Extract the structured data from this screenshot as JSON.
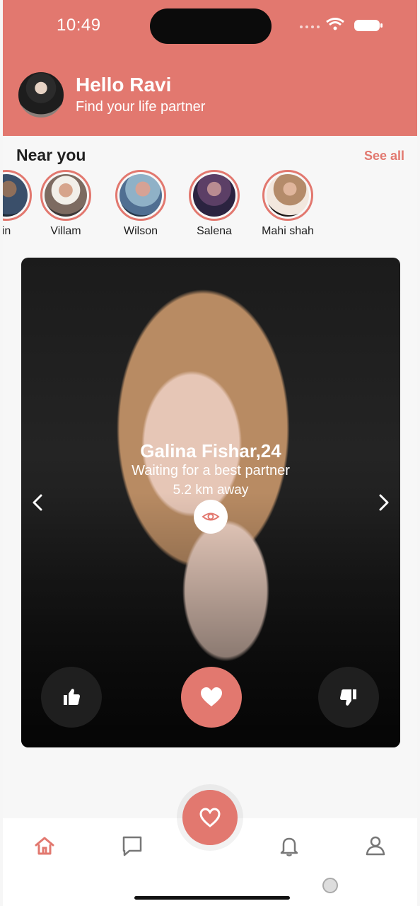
{
  "status": {
    "time": "10:49"
  },
  "header": {
    "title": "Hello Ravi",
    "subtitle": "Find your life partner"
  },
  "near_you": {
    "title": "Near you",
    "see_all": "See all",
    "items": [
      {
        "label": "in"
      },
      {
        "label": "Villam"
      },
      {
        "label": "Wilson"
      },
      {
        "label": "Salena"
      },
      {
        "label": "Mahi shah"
      }
    ]
  },
  "card": {
    "name": "Galina Fishar,24",
    "tagline": "Waiting for a best partner",
    "distance": "5.2 km away"
  },
  "colors": {
    "accent": "#e2786f",
    "dark": "#1f1f1f",
    "white": "#ffffff"
  }
}
